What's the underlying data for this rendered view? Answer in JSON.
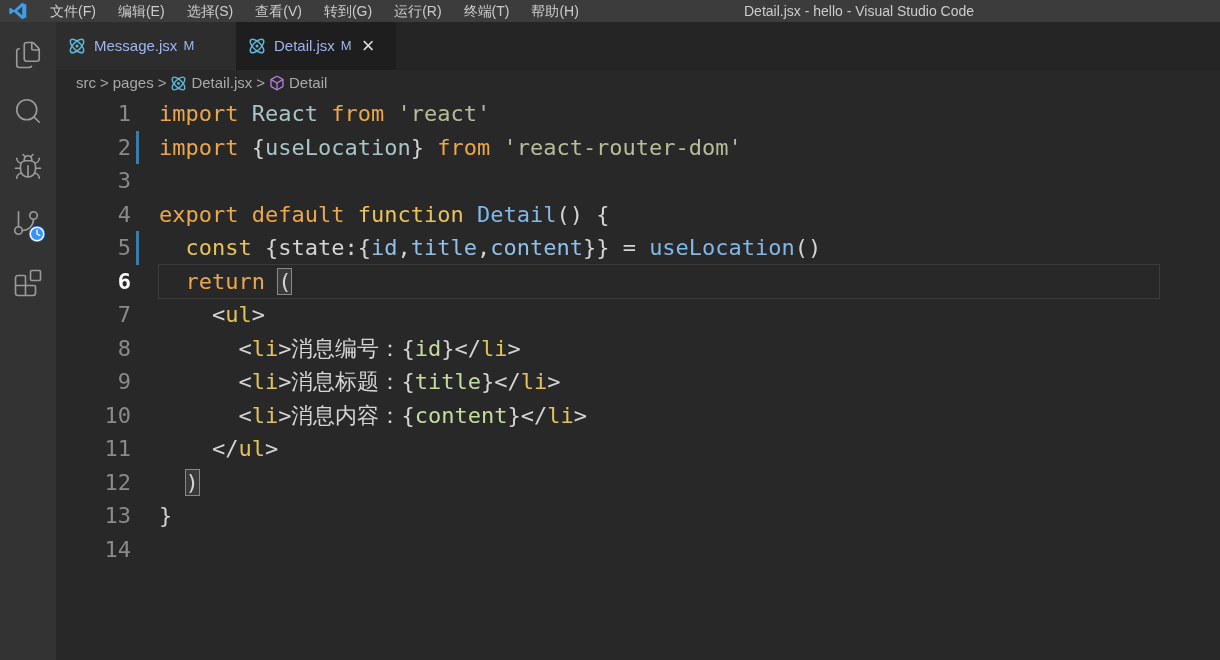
{
  "menu": [
    "文件(F)",
    "编辑(E)",
    "选择(S)",
    "查看(V)",
    "转到(G)",
    "运行(R)",
    "终端(T)",
    "帮助(H)"
  ],
  "window": {
    "title": "Detail.jsx - hello - Visual Studio Code"
  },
  "activity_bar": [
    {
      "kind": "files",
      "selected": false
    },
    {
      "kind": "search",
      "selected": false
    },
    {
      "kind": "debug",
      "selected": false
    },
    {
      "kind": "scm",
      "selected": false
    },
    {
      "kind": "extensions",
      "selected": false
    }
  ],
  "tabs": [
    {
      "label": "Message.jsx",
      "badge": "M",
      "selected": false
    },
    {
      "label": "Detail.jsx",
      "badge": "M",
      "selected": true,
      "close": "×"
    }
  ],
  "breadcrumb": [
    {
      "kind": "folder",
      "label": "src"
    },
    {
      "kind": "folder",
      "label": "pages"
    },
    {
      "kind": "file",
      "label": "Detail.jsx"
    },
    {
      "kind": "symbol",
      "label": "Detail"
    }
  ],
  "breadcrumb_separator": ">",
  "editor": {
    "lines": [
      {
        "number": "1",
        "current": false,
        "modified": false,
        "tokens": [
          {
            "kind": "kw",
            "text": "import "
          },
          {
            "kind": "ident",
            "text": "React "
          },
          {
            "kind": "kw",
            "text": "from "
          },
          {
            "kind": "str",
            "text": "'react'"
          }
        ]
      },
      {
        "number": "2",
        "current": false,
        "modified": true,
        "tokens": [
          {
            "kind": "kw",
            "text": "import "
          },
          {
            "kind": "punct",
            "text": "{"
          },
          {
            "kind": "ident",
            "text": "useLocation"
          },
          {
            "kind": "punct",
            "text": "} "
          },
          {
            "kind": "kw",
            "text": "from "
          },
          {
            "kind": "str",
            "text": "'react-router-dom'"
          }
        ]
      },
      {
        "number": "3",
        "current": false,
        "modified": false
      },
      {
        "number": "4",
        "current": false,
        "modified": false,
        "tokens": [
          {
            "kind": "kw",
            "text": "export default "
          },
          {
            "kind": "kw2",
            "text": "function "
          },
          {
            "kind": "fn",
            "text": "Detail"
          },
          {
            "kind": "punct",
            "text": "() {"
          }
        ]
      },
      {
        "number": "5",
        "current": false,
        "modified": true,
        "tokens": [
          {
            "kind": "kw2",
            "text": "  const "
          },
          {
            "kind": "punct",
            "text": "{state:{"
          },
          {
            "kind": "var",
            "text": "id"
          },
          {
            "kind": "punct",
            "text": ","
          },
          {
            "kind": "var",
            "text": "title"
          },
          {
            "kind": "punct",
            "text": ","
          },
          {
            "kind": "var",
            "text": "content"
          },
          {
            "kind": "punct",
            "text": "}} = "
          },
          {
            "kind": "fn",
            "text": "useLocation"
          },
          {
            "kind": "punct",
            "text": "()"
          }
        ]
      },
      {
        "number": "6",
        "current": true,
        "modified": false,
        "tokens": [
          {
            "kind": "kw",
            "text": "  return "
          },
          {
            "kind": "match",
            "text": "("
          }
        ]
      },
      {
        "number": "7",
        "current": false,
        "modified": false,
        "tokens": [
          {
            "kind": "punct",
            "text": "    <"
          },
          {
            "kind": "tag",
            "text": "ul"
          },
          {
            "kind": "punct",
            "text": ">"
          }
        ]
      },
      {
        "number": "8",
        "current": false,
        "modified": false,
        "tokens": [
          {
            "kind": "punct",
            "text": "      <"
          },
          {
            "kind": "tag",
            "text": "li"
          },
          {
            "kind": "punct",
            "text": ">"
          },
          {
            "kind": "cjk",
            "text": "消息编号："
          },
          {
            "kind": "punct",
            "text": "{"
          },
          {
            "kind": "expr",
            "text": "id"
          },
          {
            "kind": "punct",
            "text": "}</"
          },
          {
            "kind": "tag",
            "text": "li"
          },
          {
            "kind": "punct",
            "text": ">"
          }
        ]
      },
      {
        "number": "9",
        "current": false,
        "modified": false,
        "tokens": [
          {
            "kind": "punct",
            "text": "      <"
          },
          {
            "kind": "tag",
            "text": "li"
          },
          {
            "kind": "punct",
            "text": ">"
          },
          {
            "kind": "cjk",
            "text": "消息标题："
          },
          {
            "kind": "punct",
            "text": "{"
          },
          {
            "kind": "expr",
            "text": "title"
          },
          {
            "kind": "punct",
            "text": "}</"
          },
          {
            "kind": "tag",
            "text": "li"
          },
          {
            "kind": "punct",
            "text": ">"
          }
        ]
      },
      {
        "number": "10",
        "current": false,
        "modified": false,
        "tokens": [
          {
            "kind": "punct",
            "text": "      <"
          },
          {
            "kind": "tag",
            "text": "li"
          },
          {
            "kind": "punct",
            "text": ">"
          },
          {
            "kind": "cjk",
            "text": "消息内容："
          },
          {
            "kind": "punct",
            "text": "{"
          },
          {
            "kind": "expr",
            "text": "content"
          },
          {
            "kind": "punct",
            "text": "}</"
          },
          {
            "kind": "tag",
            "text": "li"
          },
          {
            "kind": "punct",
            "text": ">"
          }
        ]
      },
      {
        "number": "11",
        "current": false,
        "modified": false,
        "tokens": [
          {
            "kind": "punct",
            "text": "    </"
          },
          {
            "kind": "tag",
            "text": "ul"
          },
          {
            "kind": "punct",
            "text": ">"
          }
        ]
      },
      {
        "number": "12",
        "current": false,
        "modified": false,
        "tokens": [
          {
            "kind": "match",
            "text": "  )"
          }
        ]
      },
      {
        "number": "13",
        "current": false,
        "modified": false,
        "tokens": [
          {
            "kind": "punct",
            "text": "}"
          }
        ]
      },
      {
        "number": "14",
        "current": false,
        "modified": false
      }
    ]
  }
}
